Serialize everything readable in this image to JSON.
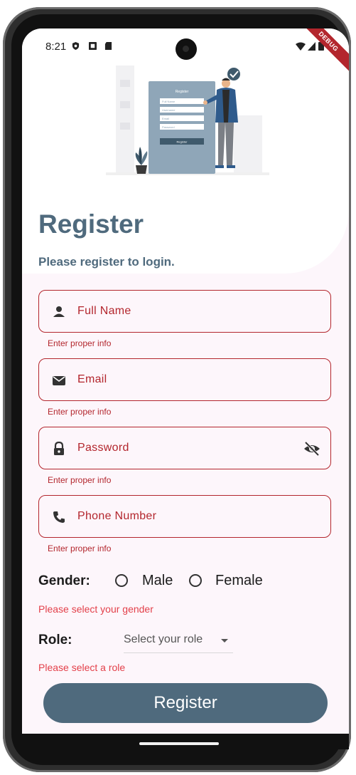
{
  "status_bar": {
    "time": "8:21"
  },
  "debug_banner": "DEBUG",
  "illustration": {
    "form_title": "Register",
    "form_fields": [
      "Full Name",
      "Username",
      "Email",
      "Password"
    ],
    "form_button": "Register"
  },
  "header": {
    "title": "Register",
    "subtitle": "Please register to login."
  },
  "fields": [
    {
      "icon": "person-icon",
      "label": "Full Name",
      "error": "Enter proper info"
    },
    {
      "icon": "email-icon",
      "label": "Email",
      "error": "Enter proper info"
    },
    {
      "icon": "lock-icon",
      "label": "Password",
      "error": "Enter proper info",
      "trailing_icon": "visibility-off-icon"
    },
    {
      "icon": "phone-icon",
      "label": "Phone Number",
      "error": "Enter proper info"
    }
  ],
  "gender": {
    "label": "Gender:",
    "options": [
      "Male",
      "Female"
    ],
    "error": "Please select your gender"
  },
  "role": {
    "label": "Role:",
    "placeholder": "Select your role",
    "error": "Please select a role"
  },
  "register_button": "Register",
  "colors": {
    "primary": "#4f6a7d",
    "error": "#b3262d",
    "background": "#fdf6fb"
  }
}
